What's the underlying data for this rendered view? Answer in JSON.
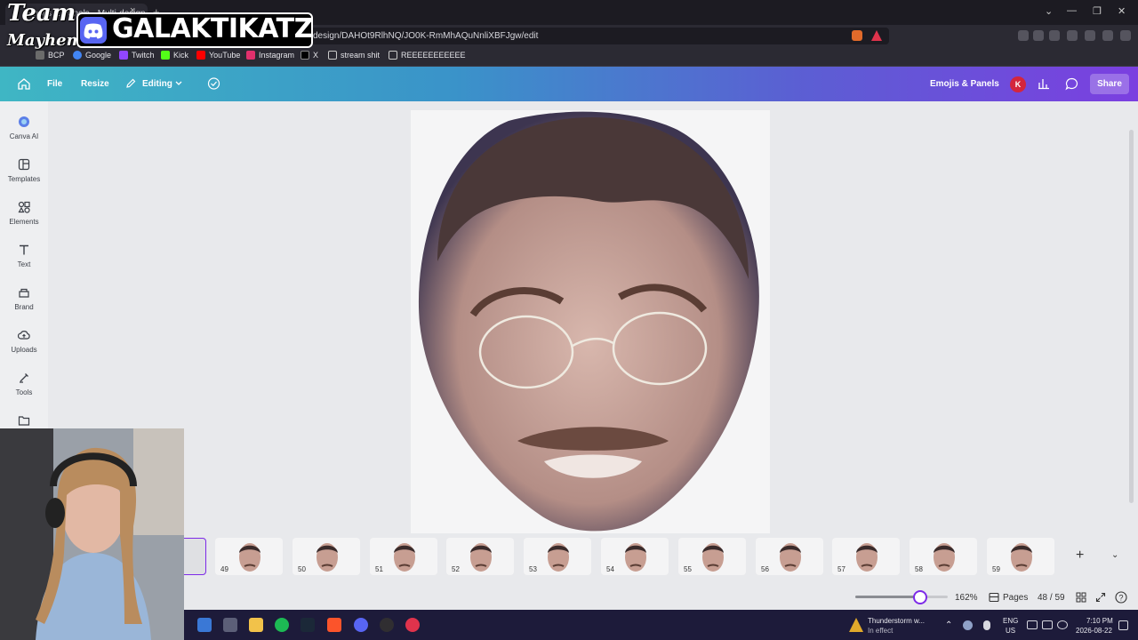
{
  "browser": {
    "tab_title": "Emojis & Panels - Multi-design",
    "tab_close": "×",
    "new_tab": "+",
    "url": "design/DAHOt9RlhNQ/JO0K-RmMhAQuNnliXBFJgw/edit",
    "window_controls": [
      "⌄",
      "—",
      "❐",
      "✕"
    ],
    "bookmarks": [
      {
        "label": "BCP",
        "color": "#6b6b6b"
      },
      {
        "label": "Google",
        "color": "#4285f4"
      },
      {
        "label": "Twitch",
        "color": "#9146ff"
      },
      {
        "label": "Kick",
        "color": "#53fc18"
      },
      {
        "label": "YouTube",
        "color": "#ff0000"
      },
      {
        "label": "Instagram",
        "color": "#e1306c"
      },
      {
        "label": "X",
        "color": "#000000"
      },
      {
        "label": "stream shit",
        "color": "#c9c9c9"
      },
      {
        "label": "REEEEEEEEEEE",
        "color": "#c9c9c9"
      }
    ]
  },
  "canva": {
    "header": {
      "home_icon": "home-icon",
      "file": "File",
      "resize": "Resize",
      "editing": "Editing",
      "design_title": "Emojis & Panels",
      "avatar_initial": "K",
      "share": "Share"
    },
    "sidebar": [
      {
        "label": "Canva AI",
        "icon": "canva-ai-icon"
      },
      {
        "label": "Templates",
        "icon": "templates-icon"
      },
      {
        "label": "Elements",
        "icon": "elements-icon"
      },
      {
        "label": "Text",
        "icon": "text-icon"
      },
      {
        "label": "Brand",
        "icon": "brand-icon"
      },
      {
        "label": "Uploads",
        "icon": "uploads-icon"
      },
      {
        "label": "Tools",
        "icon": "tools-icon"
      },
      {
        "label": "",
        "icon": "folder-icon"
      }
    ],
    "filmstrip": {
      "pages": [
        "49",
        "50",
        "51",
        "52",
        "53",
        "54",
        "55",
        "56",
        "57",
        "58",
        "59"
      ],
      "add": "+",
      "collapse": "⌄"
    },
    "bottombar": {
      "zoom": "162%",
      "zoom_level": 0.7,
      "pages_label": "Pages",
      "page_counter": "48 / 59",
      "help": "?"
    }
  },
  "taskbar": {
    "weather_title": "Thunderstorm w...",
    "weather_sub": "In effect",
    "lang": "ENG",
    "region": "US",
    "time": "7:10 PM",
    "date": "2026-08-22"
  },
  "overlay": {
    "team_line1": "Team",
    "team_line2": "Mayhem",
    "discord_name": "GALAKTIKATZ"
  },
  "colors": {
    "brand_purple": "#7d2ae8",
    "header_start": "#3fb6c4",
    "header_end": "#7b3fe0",
    "discord": "#5865f2"
  }
}
